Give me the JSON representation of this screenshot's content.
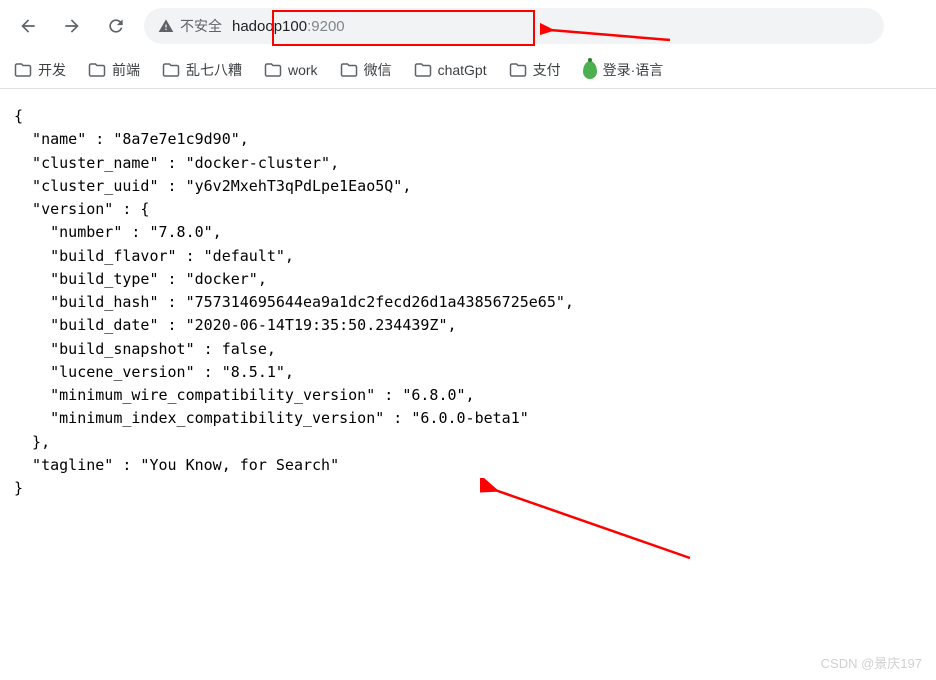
{
  "toolbar": {
    "security_label": "不安全",
    "url_host": "hadoop100",
    "url_port": ":9200"
  },
  "bookmarks": {
    "items": [
      {
        "label": "开发"
      },
      {
        "label": "前端"
      },
      {
        "label": "乱七八糟"
      },
      {
        "label": "work"
      },
      {
        "label": "微信"
      },
      {
        "label": "chatGpt"
      },
      {
        "label": "支付"
      }
    ],
    "extra": "登录·语言"
  },
  "response": {
    "name": "8a7e7e1c9d90",
    "cluster_name": "docker-cluster",
    "cluster_uuid": "y6v2MxehT3qPdLpe1Eao5Q",
    "version": {
      "number": "7.8.0",
      "build_flavor": "default",
      "build_type": "docker",
      "build_hash": "757314695644ea9a1dc2fecd26d1a43856725e65",
      "build_date": "2020-06-14T19:35:50.234439Z",
      "build_snapshot": "false",
      "lucene_version": "8.5.1",
      "minimum_wire_compatibility_version": "6.8.0",
      "minimum_index_compatibility_version": "6.0.0-beta1"
    },
    "tagline": "You Know, for Search"
  },
  "watermark": "CSDN @景庆197"
}
